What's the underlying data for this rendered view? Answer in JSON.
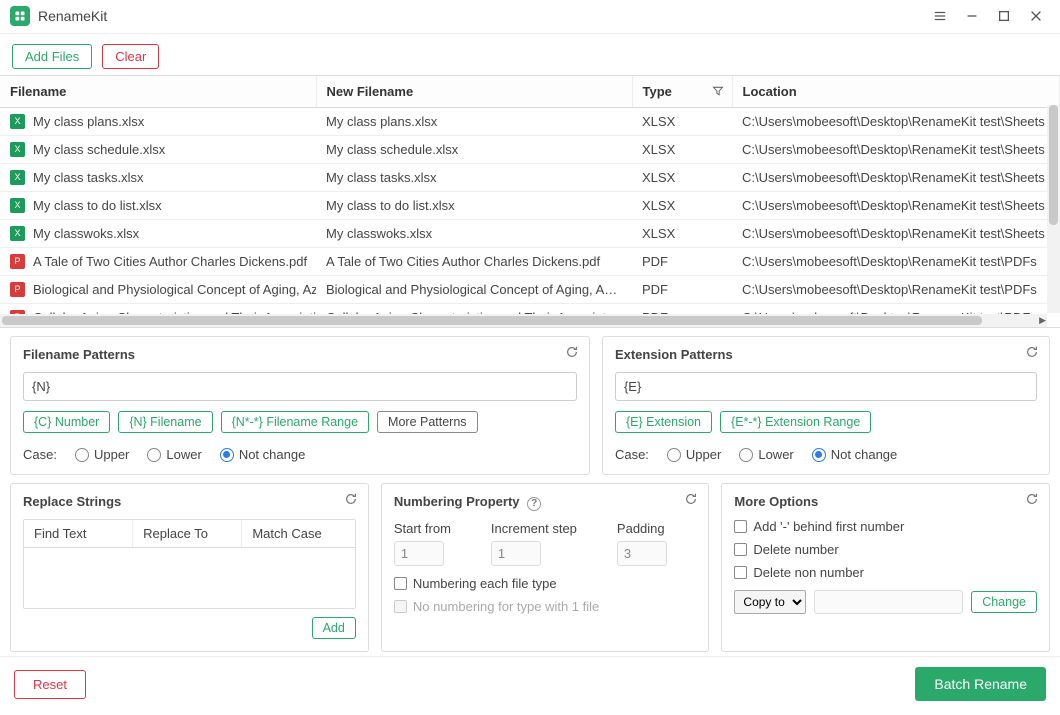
{
  "app": {
    "title": "RenameKit"
  },
  "toolbar": {
    "add_files": "Add Files",
    "clear": "Clear"
  },
  "table": {
    "headers": {
      "filename": "Filename",
      "new_filename": "New Filename",
      "type": "Type",
      "location": "Location"
    },
    "rows": [
      {
        "icon": "xlsx",
        "filename": "My class plans.xlsx",
        "new_filename": "My class plans.xlsx",
        "type": "XLSX",
        "location": "C:\\Users\\mobeesoft\\Desktop\\RenameKit test\\Sheets"
      },
      {
        "icon": "xlsx",
        "filename": "My class schedule.xlsx",
        "new_filename": "My class schedule.xlsx",
        "type": "XLSX",
        "location": "C:\\Users\\mobeesoft\\Desktop\\RenameKit test\\Sheets"
      },
      {
        "icon": "xlsx",
        "filename": "My class tasks.xlsx",
        "new_filename": "My class tasks.xlsx",
        "type": "XLSX",
        "location": "C:\\Users\\mobeesoft\\Desktop\\RenameKit test\\Sheets"
      },
      {
        "icon": "xlsx",
        "filename": "My class to do list.xlsx",
        "new_filename": "My class to do list.xlsx",
        "type": "XLSX",
        "location": "C:\\Users\\mobeesoft\\Desktop\\RenameKit test\\Sheets"
      },
      {
        "icon": "xlsx",
        "filename": "My classwoks.xlsx",
        "new_filename": "My classwoks.xlsx",
        "type": "XLSX",
        "location": "C:\\Users\\mobeesoft\\Desktop\\RenameKit test\\Sheets"
      },
      {
        "icon": "pdf",
        "filename": "A Tale of Two Cities Author Charles Dickens.pdf",
        "new_filename": "A Tale of Two Cities Author Charles Dickens.pdf",
        "type": "PDF",
        "location": "C:\\Users\\mobeesoft\\Desktop\\RenameKit test\\PDFs"
      },
      {
        "icon": "pdf",
        "filename": "Biological and Physiological Concept of Aging, Azza S.",
        "new_filename": "Biological and Physiological Concept of Aging, Azza S.",
        "type": "PDF",
        "location": "C:\\Users\\mobeesoft\\Desktop\\RenameKit test\\PDFs"
      },
      {
        "icon": "pdf",
        "filename": "Cellular Aging Characteristics and Their Association wi",
        "new_filename": "Cellular Aging Characteristics and Their Association wi",
        "type": "PDF",
        "location": "C:\\Users\\mobeesoft\\Desktop\\RenameKit test\\PDFs"
      }
    ]
  },
  "filename_patterns": {
    "title": "Filename Patterns",
    "value": "{N}",
    "chips": {
      "c_number": "{C} Number",
      "n_filename": "{N} Filename",
      "n_range": "{N*-*} Filename Range",
      "more": "More Patterns"
    },
    "case_label": "Case:",
    "case_upper": "Upper",
    "case_lower": "Lower",
    "case_notchange": "Not change"
  },
  "extension_patterns": {
    "title": "Extension Patterns",
    "value": "{E}",
    "chips": {
      "e_ext": "{E} Extension",
      "e_range": "{E*-*} Extension Range"
    },
    "case_label": "Case:",
    "case_upper": "Upper",
    "case_lower": "Lower",
    "case_notchange": "Not change"
  },
  "replace_strings": {
    "title": "Replace Strings",
    "col_find": "Find Text",
    "col_replace": "Replace To",
    "col_matchcase": "Match Case",
    "add": "Add"
  },
  "numbering": {
    "title": "Numbering Property",
    "start_from_label": "Start from",
    "start_from": "1",
    "increment_label": "Increment step",
    "increment": "1",
    "padding_label": "Padding",
    "padding": "3",
    "each_type": "Numbering each file type",
    "no_numbering_single": "No numbering for type with 1 file"
  },
  "more_options": {
    "title": "More Options",
    "add_dash": "Add '-' behind first number",
    "delete_number": "Delete number",
    "delete_non_number": "Delete non number",
    "copy_to": "Copy to",
    "change": "Change"
  },
  "footer": {
    "reset": "Reset",
    "batch_rename": "Batch Rename"
  }
}
